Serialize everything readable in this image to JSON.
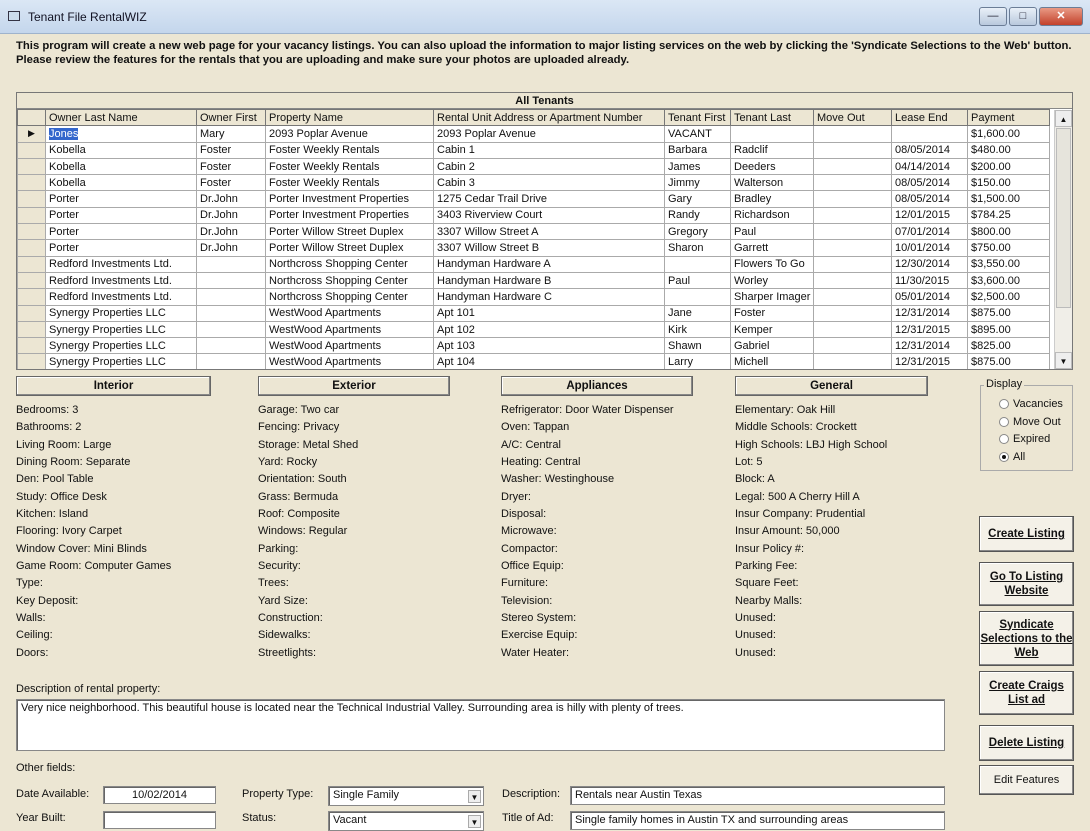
{
  "window": {
    "title": "Tenant File RentalWIZ",
    "minimize": "—",
    "maximize": "□",
    "close": "✕"
  },
  "intro": "This program will create a new web page for your vacancy listings. You can also upload the information to major listing services on the web by clicking the 'Syndicate Selections to the Web' button. Please review the features for the rentals that you are uploading and make sure your photos are uploaded already.",
  "grid": {
    "caption": "All Tenants",
    "columns": [
      "Owner Last Name",
      "Owner First",
      "Property Name",
      "Rental Unit Address or Apartment Number",
      "Tenant First",
      "Tenant Last",
      "Move Out",
      "Lease End",
      "Payment"
    ],
    "rows": [
      [
        "Jones",
        "Mary",
        "2093 Poplar Avenue",
        "2093 Poplar Avenue",
        "VACANT",
        "",
        "",
        "",
        "$1,600.00"
      ],
      [
        "Kobella",
        "Foster",
        "Foster Weekly Rentals",
        "Cabin 1",
        "Barbara",
        "Radclif",
        "",
        "08/05/2014",
        "$480.00"
      ],
      [
        "Kobella",
        "Foster",
        "Foster Weekly Rentals",
        "Cabin 2",
        "James",
        "Deeders",
        "",
        "04/14/2014",
        "$200.00"
      ],
      [
        "Kobella",
        "Foster",
        "Foster Weekly Rentals",
        "Cabin 3",
        "Jimmy",
        "Walterson",
        "",
        "08/05/2014",
        "$150.00"
      ],
      [
        "Porter",
        "Dr.John",
        "Porter Investment Properties",
        "1275 Cedar Trail Drive",
        "Gary",
        "Bradley",
        "",
        "08/05/2014",
        "$1,500.00"
      ],
      [
        "Porter",
        "Dr.John",
        "Porter Investment Properties",
        "3403 Riverview Court",
        "Randy",
        "Richardson",
        "",
        "12/01/2015",
        "$784.25"
      ],
      [
        "Porter",
        "Dr.John",
        "Porter Willow Street Duplex",
        "3307 Willow Street A",
        "Gregory",
        "Paul",
        "",
        "07/01/2014",
        "$800.00"
      ],
      [
        "Porter",
        "Dr.John",
        "Porter Willow Street Duplex",
        "3307 Willow Street B",
        "Sharon",
        "Garrett",
        "",
        "10/01/2014",
        "$750.00"
      ],
      [
        "Redford Investments Ltd.",
        "",
        "Northcross Shopping Center",
        "Handyman Hardware A",
        "",
        "Flowers To Go",
        "",
        "12/30/2014",
        "$3,550.00"
      ],
      [
        "Redford Investments Ltd.",
        "",
        "Northcross Shopping Center",
        "Handyman Hardware B",
        "Paul",
        "Worley",
        "",
        "11/30/2015",
        "$3,600.00"
      ],
      [
        "Redford Investments Ltd.",
        "",
        "Northcross Shopping Center",
        "Handyman Hardware C",
        "",
        "Sharper Imager",
        "",
        "05/01/2014",
        "$2,500.00"
      ],
      [
        "Synergy Properties LLC",
        "",
        "WestWood Apartments",
        "Apt 101",
        "Jane",
        "Foster",
        "",
        "12/31/2014",
        "$875.00"
      ],
      [
        "Synergy Properties LLC",
        "",
        "WestWood Apartments",
        "Apt 102",
        "Kirk",
        "Kemper",
        "",
        "12/31/2015",
        "$895.00"
      ],
      [
        "Synergy Properties LLC",
        "",
        "WestWood Apartments",
        "Apt 103",
        "Shawn",
        "Gabriel",
        "",
        "12/31/2014",
        "$825.00"
      ],
      [
        "Synergy Properties LLC",
        "",
        "WestWood Apartments",
        "Apt 104",
        "Larry",
        "Michell",
        "",
        "12/31/2015",
        "$875.00"
      ]
    ]
  },
  "features": [
    {
      "title": "Interior",
      "items": [
        "Bedrooms: 3",
        "Bathrooms: 2",
        "Living Room: Large",
        "Dining Room: Separate",
        "Den: Pool Table",
        "Study: Office Desk",
        "Kitchen: Island",
        "Flooring: Ivory Carpet",
        "Window Cover: Mini Blinds",
        "Game Room: Computer Games",
        "Type:",
        "Key Deposit:",
        "Walls:",
        "Ceiling:",
        "Doors:"
      ]
    },
    {
      "title": "Exterior",
      "items": [
        "Garage: Two car",
        "Fencing: Privacy",
        "Storage: Metal Shed",
        "Yard: Rocky",
        "Orientation: South",
        "Grass: Bermuda",
        "Roof: Composite",
        "Windows: Regular",
        "Parking:",
        "Security:",
        "Trees:",
        "Yard Size:",
        "Construction:",
        "Sidewalks:",
        "Streetlights:"
      ]
    },
    {
      "title": "Appliances",
      "items": [
        "Refrigerator: Door Water Dispenser",
        "Oven: Tappan",
        "A/C: Central",
        "Heating: Central",
        "Washer: Westinghouse",
        "Dryer:",
        "Disposal:",
        "Microwave:",
        "Compactor:",
        "Office Equip:",
        "Furniture:",
        "Television:",
        "Stereo System:",
        "Exercise Equip:",
        "Water Heater:"
      ]
    },
    {
      "title": "General",
      "items": [
        "Elementary: Oak Hill",
        "Middle Schools: Crockett",
        "High Schools: LBJ High School",
        "Lot: 5",
        "Block: A",
        "Legal: 500 A Cherry Hill A",
        "Insur Company: Prudential",
        "Insur Amount: 50,000",
        "Insur Policy #:",
        "Parking Fee:",
        "Square Feet:",
        "Nearby Malls:",
        "Unused:",
        "Unused:",
        "Unused:"
      ]
    }
  ],
  "display": {
    "label": "Display",
    "options": [
      "Vacancies",
      "Move Out",
      "Expired",
      "All"
    ],
    "selected": "All"
  },
  "buttons": [
    "Create Listing",
    "Go To Listing Website",
    "Syndicate Selections to the Web",
    "Create Craigs List ad",
    "Delete Listing",
    "Edit Features"
  ],
  "description": {
    "label": "Description of rental property:",
    "value": "Very nice neighborhood.  This beautiful house is located near the Technical Industrial Valley.  Surrounding area is hilly with plenty of trees."
  },
  "other": {
    "label": "Other fields:",
    "date_available_label": "Date Available:",
    "date_available": "10/02/2014",
    "property_type_label": "Property Type:",
    "property_type": "Single Family",
    "desc_label": "Description:",
    "desc": "Rentals near Austin Texas",
    "year_built_label": "Year Built:",
    "year_built": "",
    "status_label": "Status:",
    "status": "Vacant",
    "title_label": "Title of Ad:",
    "title": "Single family homes in Austin TX and surrounding areas"
  }
}
